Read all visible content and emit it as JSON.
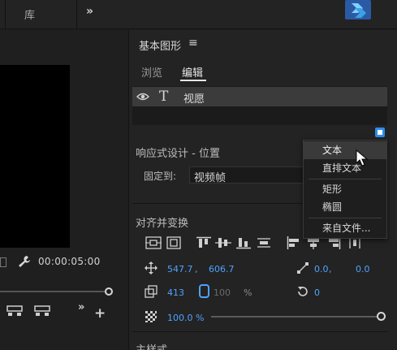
{
  "topbar": {
    "library_tab": "库",
    "more_glyph": "»"
  },
  "left_panel": {
    "timecode": "00:00:05:00",
    "more_glyph": "»",
    "add_glyph": "+"
  },
  "right_panel": {
    "title": "基本图形",
    "menu_glyph": "≡",
    "tabs": {
      "browse": "浏览",
      "edit": "编辑"
    },
    "layers": [
      {
        "name": "视愿"
      }
    ],
    "responsive_section": "响应式设计 - 位置",
    "pin_label": "固定到:",
    "pin_value": "视频帧",
    "align_section": "对齐并变换",
    "position": {
      "x": "547.7",
      "y": "606.7",
      "separator": ","
    },
    "anchor": {
      "x": "0.0",
      "y": "0.0",
      "separator": ","
    },
    "scale": {
      "value": "413",
      "width": "100",
      "unit": "%"
    },
    "rotation": "0",
    "opacity": {
      "value": "100.0 %",
      "level": 1.0
    },
    "master_styles_section": "主样式"
  },
  "new_layer_menu": {
    "items": [
      "文本",
      "直排文本",
      "矩形",
      "椭圆",
      "来自文件..."
    ],
    "highlighted": "文本"
  },
  "colors": {
    "accent": "#4ea3ff",
    "button_blue": "#2d8ceb",
    "panel_bg": "#232323"
  }
}
